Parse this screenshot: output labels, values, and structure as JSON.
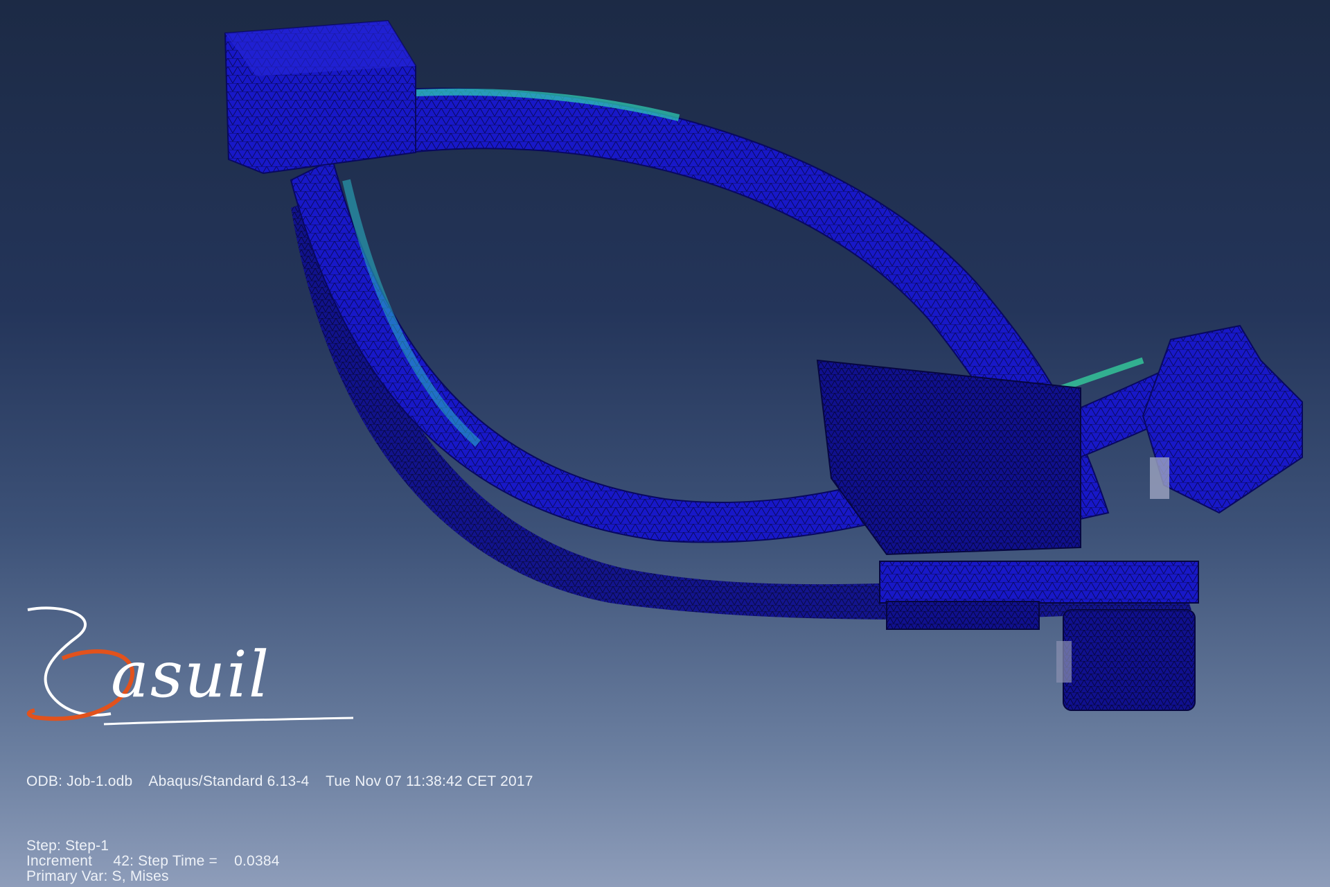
{
  "viewport": {
    "background_top": "#1c2a45",
    "background_bottom": "#8e9dba",
    "model": {
      "description_colors": {
        "mesh_base": "#1a1ad0",
        "mesh_dark": "#0c0c7a",
        "stress_mid": "#1e9fd8",
        "stress_high": "#38e0a0"
      }
    }
  },
  "logo": {
    "word": "asuil",
    "initial_color": "#ffffff",
    "swoosh_color": "#e2521c"
  },
  "info": {
    "odb_line": "ODB: Job-1.odb    Abaqus/Standard 6.13-4    Tue Nov 07 11:38:42 CET 2017",
    "step_line": "Step: Step-1",
    "increment_line": "Increment     42: Step Time =    0.0384",
    "primary_var_line": "Primary Var: S, Mises"
  }
}
